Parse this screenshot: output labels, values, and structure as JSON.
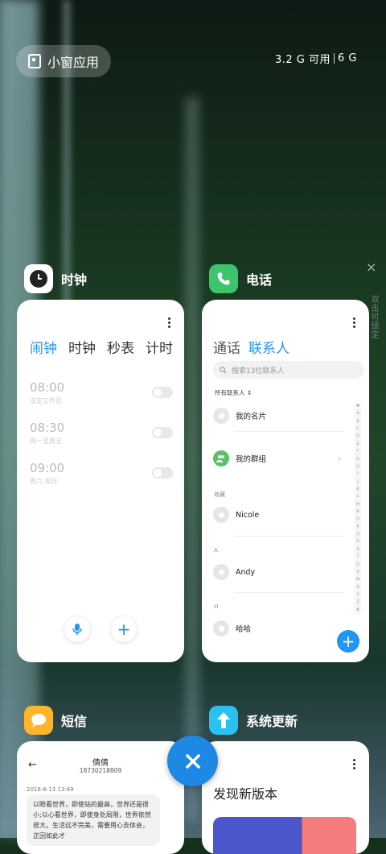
{
  "top": {
    "pill_label": "小窗应用",
    "memory_free": "3.2 G 可用",
    "memory_total": "6 G"
  },
  "side": {
    "close_glyph": "×",
    "vertical_text": "双击可锁定"
  },
  "clock": {
    "app_name": "时钟",
    "tabs": [
      "闹钟",
      "时钟",
      "秒表",
      "计时"
    ],
    "alarms": [
      {
        "time": "08:00",
        "sub": "法定工作日"
      },
      {
        "time": "08:30",
        "sub": "周一至周五"
      },
      {
        "time": "09:00",
        "sub": "周六 周日"
      }
    ]
  },
  "phone": {
    "app_name": "电话",
    "tabs": [
      "通话",
      "联系人"
    ],
    "search_placeholder": "搜索13位联系人",
    "all_contacts": "所有联系人",
    "contacts": [
      {
        "name": "我的名片"
      },
      {
        "name": "我的群组"
      },
      {
        "section": "收藏"
      },
      {
        "name": "Nicole"
      },
      {
        "section": "A"
      },
      {
        "name": "Andy"
      },
      {
        "section": "H"
      },
      {
        "name": "哈哈"
      }
    ],
    "alphabet": [
      "♥",
      "A",
      "B",
      "C",
      "D",
      "E",
      "F",
      "G",
      "H",
      "I",
      "J",
      "K",
      "L",
      "M",
      "N",
      "O",
      "P",
      "Q",
      "R",
      "S",
      "T",
      "U",
      "V",
      "W",
      "X",
      "Y",
      "Z",
      "#"
    ]
  },
  "sms": {
    "app_name": "短信",
    "contact_name": "倩倩",
    "number": "18730218809",
    "date": "2016-6-13 13:49",
    "message": "以眼看世界，即使站的最高，世界还是很小;以心看世界，即使身处局限，世界依然很大。生活远不完美，需要用心去体会，正因如此才"
  },
  "update": {
    "app_name": "系统更新",
    "title": "发现新版本"
  },
  "colors": {
    "accent": "#2196f3",
    "clock_icon": "#ffffff",
    "phone_icon": "#3ec46d",
    "sms_icon": "#ffb429",
    "update_icon": "#29c1ef"
  }
}
